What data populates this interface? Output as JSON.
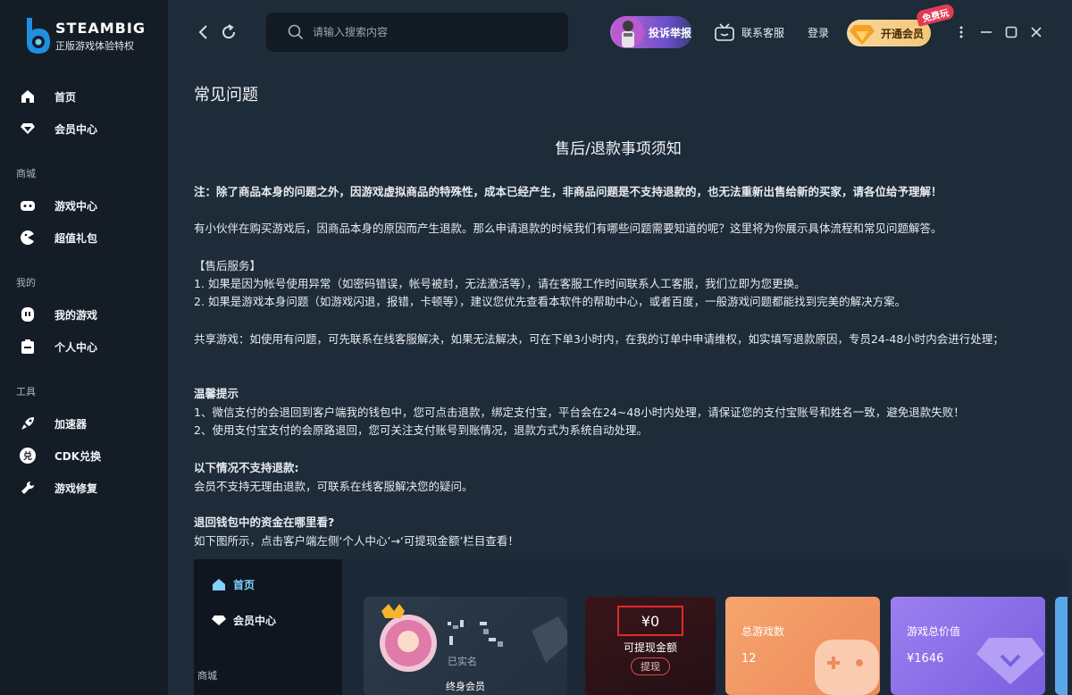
{
  "brand": {
    "name": "STEAMBIG",
    "tagline": "正版游戏体验特权"
  },
  "sidebar": {
    "items_top": [
      {
        "label": "首页",
        "icon": "home-icon"
      },
      {
        "label": "会员中心",
        "icon": "diamond-icon"
      }
    ],
    "section_store": "商城",
    "items_store": [
      {
        "label": "游戏中心",
        "icon": "gamepad-icon"
      },
      {
        "label": "超值礼包",
        "icon": "gift-icon"
      }
    ],
    "section_mine": "我的",
    "items_mine": [
      {
        "label": "我的游戏",
        "icon": "controller-icon"
      },
      {
        "label": "个人中心",
        "icon": "clipboard-icon"
      }
    ],
    "section_tools": "工具",
    "items_tools": [
      {
        "label": "加速器",
        "icon": "rocket-icon"
      },
      {
        "label": "CDK兑换",
        "icon": "exchange-icon"
      },
      {
        "label": "游戏修复",
        "icon": "wrench-icon"
      }
    ]
  },
  "topbar": {
    "search_placeholder": "请输入搜索内容",
    "report_label": "投诉举报",
    "service_label": "联系客服",
    "login_label": "登录",
    "vip_label": "开通会员",
    "free_tag": "免费玩"
  },
  "content": {
    "page_title": "常见问题",
    "article_title": "售后/退款事项须知",
    "note": "注：除了商品本身的问题之外，因游戏虚拟商品的特殊性，成本已经产生，非商品问题是不支持退款的，也无法重新出售给新的买家，请各位给予理解！",
    "intro": "有小伙伴在购买游戏后，因商品本身的原因而产生退款。那么申请退款的时候我们有哪些问题需要知道的呢？这里将为你展示具体流程和常见问题解答。",
    "after_sales_heading": "【售后服务】",
    "after_sales_1": "1. 如果是因为帐号使用异常（如密码错误，帐号被封，无法激活等），请在客服工作时间联系人工客服，我们立即为您更换。",
    "after_sales_2": "2. 如果是游戏本身问题（如游戏闪退，报错，卡顿等），建议您优先查看本软件的帮助中心，或者百度，一般游戏问题都能找到完美的解决方案。",
    "shared_games": "共享游戏：如使用有问题，可先联系在线客服解决，如果无法解决，可在下单3小时内，在我的订单中申请维权，如实填写退款原因，专员24-48小时内会进行处理；",
    "tips_heading": "温馨提示",
    "tips_1": "1、微信支付的会退回到客户端我的钱包中，您可点击退款，绑定支付宝，平台会在24~48小时内处理，请保证您的支付宝账号和姓名一致，避免退款失败！",
    "tips_2": "2、使用支付宝支付的会原路退回，您可关注支付账号到账情况，退款方式为系统自动处理。",
    "no_refund_heading": "以下情况不支持退款:",
    "no_refund_text": "会员不支持无理由退款，可联系在线客服解决您的疑问。",
    "wallet_heading": "退回钱包中的资金在哪里看?",
    "wallet_text": "如下图所示，点击客户端左侧‘个人中心’→‘可提现金额’栏目查看！"
  },
  "screenshot": {
    "nav_home": "首页",
    "nav_vip": "会员中心",
    "section_store": "商城",
    "user_status": "已实名",
    "user_level": "终身会员",
    "wallet_amount": "¥0",
    "wallet_label": "可提现金额",
    "withdraw_label": "提现",
    "games_label": "总游戏数",
    "games_value": "12",
    "value_label": "游戏总价值",
    "value_amount": "¥1646"
  }
}
